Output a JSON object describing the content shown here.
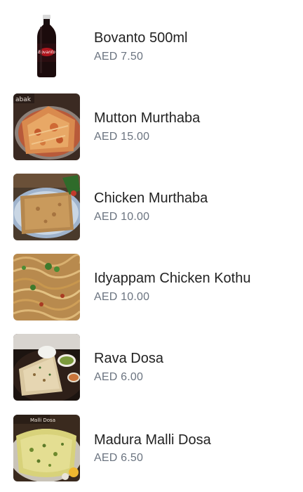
{
  "menu": {
    "items": [
      {
        "name": "Bovanto 500ml",
        "price": "AED 7.50",
        "image": "soda-bottle-image"
      },
      {
        "name": "Mutton Murthaba",
        "price": "AED 15.00",
        "image": "mutton-murthaba-image",
        "image_caption": "abak"
      },
      {
        "name": "Chicken Murthaba",
        "price": "AED 10.00",
        "image": "chicken-murthaba-image"
      },
      {
        "name": "Idyappam Chicken Kothu",
        "price": "AED 10.00",
        "image": "idyappam-kothu-image"
      },
      {
        "name": "Rava Dosa",
        "price": "AED 6.00",
        "image": "rava-dosa-image"
      },
      {
        "name": "Madura Malli Dosa",
        "price": "AED 6.50",
        "image": "madura-malli-dosa-image",
        "image_caption": "Malli Dosa"
      }
    ]
  }
}
